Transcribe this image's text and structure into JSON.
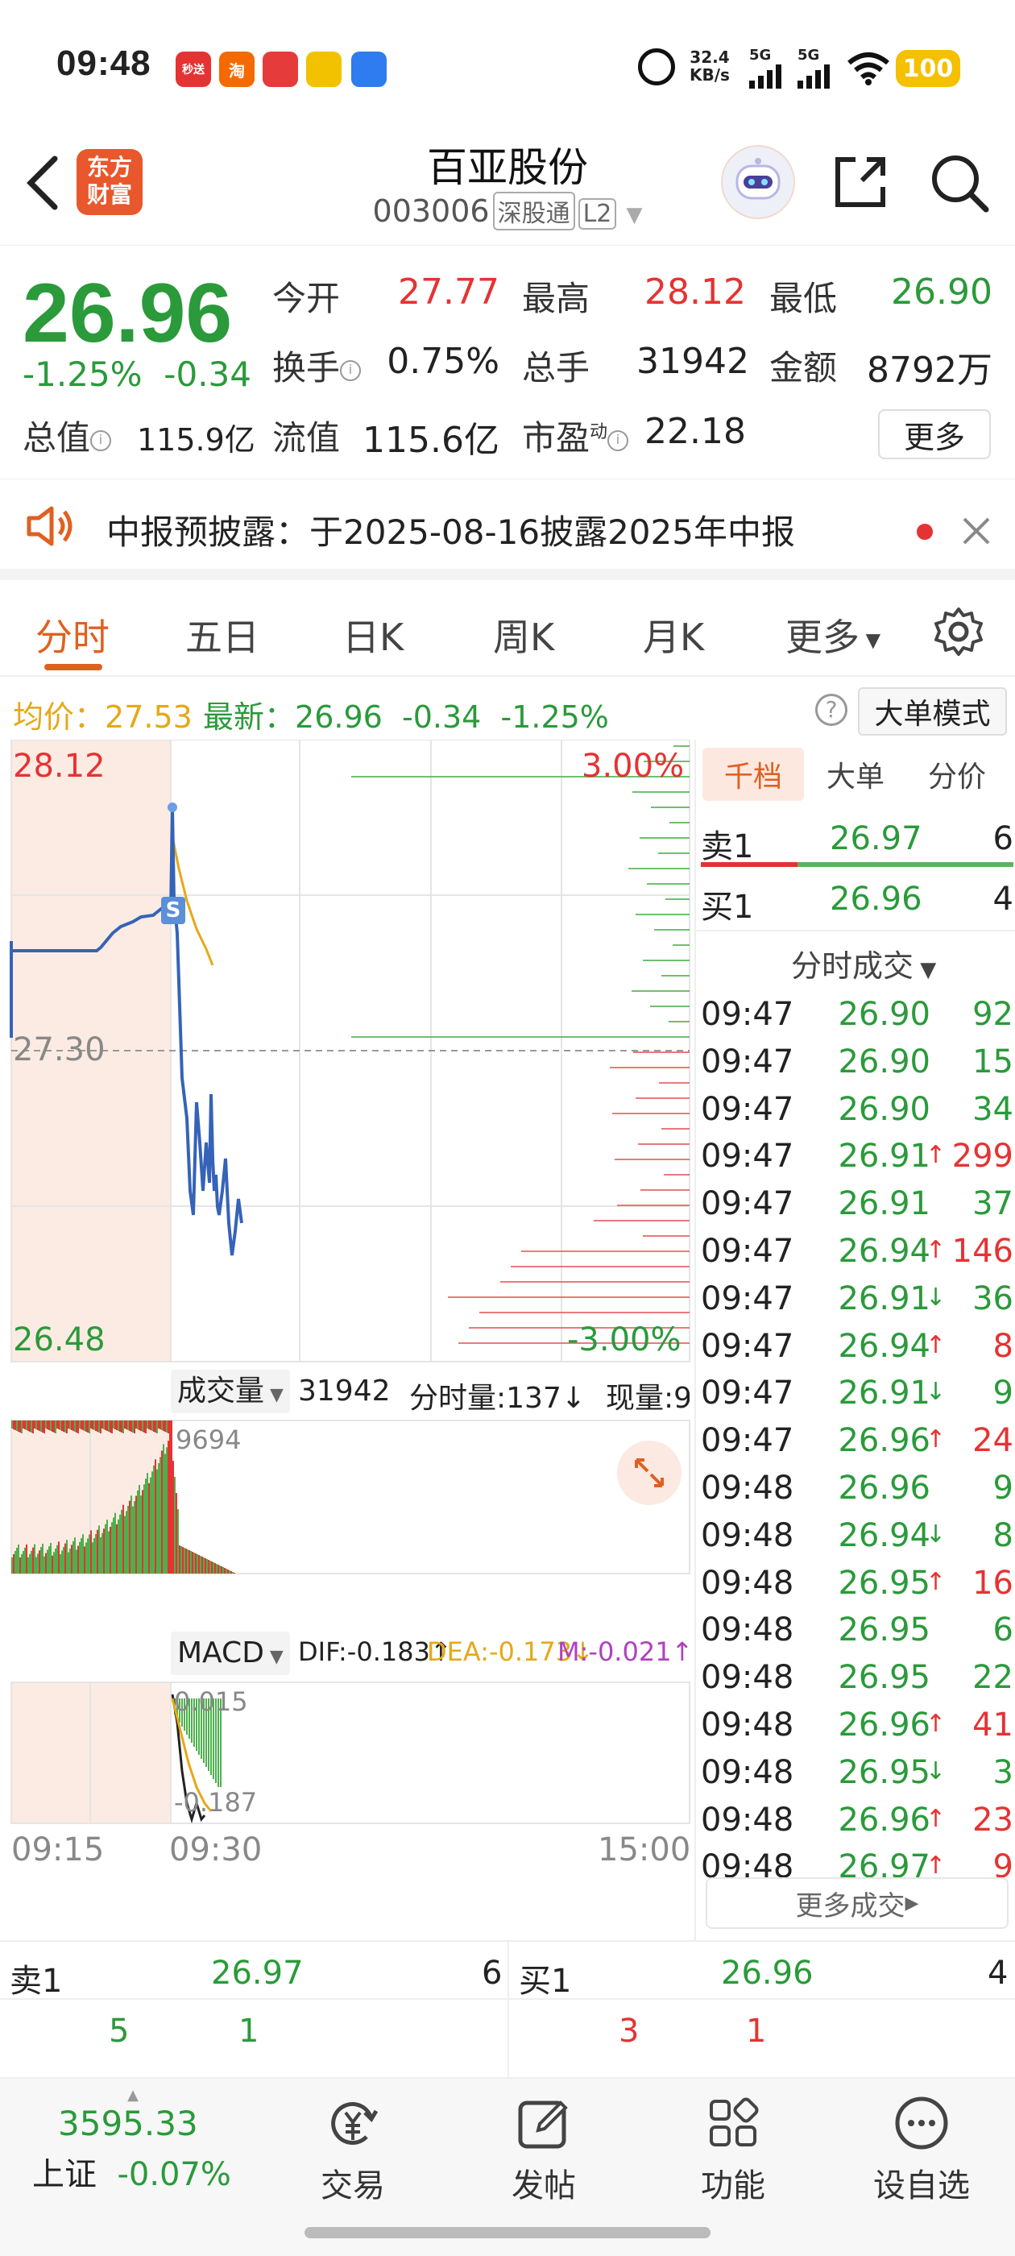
{
  "status_bar": {
    "time": "09:48",
    "net_speed": "32.4\nKB/s",
    "net_top": "32.4",
    "net_bottom": "KB/s",
    "signal1": "5G",
    "signal2": "5G",
    "battery": "100",
    "app_icons": [
      "秒送",
      "淘",
      "",
      "",
      ""
    ]
  },
  "header": {
    "logo_line1": "东方",
    "logo_line2": "财富",
    "stock_name": "百亚股份",
    "stock_code": "003006",
    "tag1": "深股通",
    "tag2": "L2"
  },
  "quote": {
    "price": "26.96",
    "change_pct": "-1.25%",
    "change": "-0.34",
    "open_label": "今开",
    "open_value": "27.77",
    "high_label": "最高",
    "high_value": "28.12",
    "low_label": "最低",
    "low_value": "26.90",
    "turnover_label": "换手",
    "turnover_value": "0.75%",
    "volume_label": "总手",
    "volume_value": "31942",
    "amount_label": "金额",
    "amount_value": "8792万",
    "mktcap_label": "总值",
    "mktcap_value": "115.9亿",
    "float_label": "流值",
    "float_value": "115.6亿",
    "pe_label": "市盈",
    "pe_sup": "动",
    "pe_value": "22.18",
    "more": "更多"
  },
  "notice": {
    "text": "中报预披露：于2025-08-16披露2025年中报"
  },
  "tabs": [
    "分时",
    "五日",
    "日K",
    "周K",
    "月K",
    "更多"
  ],
  "avg_line": {
    "avg_label": "均价：",
    "avg_value": "27.53",
    "latest_label": "最新：",
    "latest_value": "26.96",
    "change": "-0.34",
    "change_pct": "-1.25%",
    "mode_button": "大单模式"
  },
  "chart": {
    "y_high": "28.12",
    "y_mid": "27.30",
    "y_low": "26.48",
    "pct_high": "3.00%",
    "pct_low": "-3.00%",
    "marker": "S",
    "volume_label": "成交量",
    "volume_total": "31942",
    "tick_volume": "分时量:137↓",
    "current_volume": "现量:9",
    "vol_max": "9694",
    "macd_label": "MACD",
    "dif": "DIF:-0.183↑",
    "dea": "DEA:-0.173↓",
    "m": "M:-0.021↑",
    "macd_high": "0.015",
    "macd_low": "-0.187",
    "time_start": "09:15",
    "time_open": "09:30",
    "time_end": "15:00"
  },
  "order_book": {
    "tabs": [
      "千档",
      "大单",
      "分价"
    ],
    "sell1_label": "卖1",
    "sell1_price": "26.97",
    "sell1_qty": "6",
    "buy1_label": "买1",
    "buy1_price": "26.96",
    "buy1_qty": "4",
    "ticks_title": "分时成交",
    "ticks": [
      {
        "time": "09:47",
        "price": "26.90",
        "arrow": "",
        "qty": "92",
        "color": "green"
      },
      {
        "time": "09:47",
        "price": "26.90",
        "arrow": "",
        "qty": "15",
        "color": "green"
      },
      {
        "time": "09:47",
        "price": "26.90",
        "arrow": "",
        "qty": "34",
        "color": "green"
      },
      {
        "time": "09:47",
        "price": "26.91",
        "arrow": "↑",
        "qty": "299",
        "color": "red"
      },
      {
        "time": "09:47",
        "price": "26.91",
        "arrow": "",
        "qty": "37",
        "color": "green"
      },
      {
        "time": "09:47",
        "price": "26.94",
        "arrow": "↑",
        "qty": "146",
        "color": "red"
      },
      {
        "time": "09:47",
        "price": "26.91",
        "arrow": "↓",
        "qty": "36",
        "color": "green"
      },
      {
        "time": "09:47",
        "price": "26.94",
        "arrow": "↑",
        "qty": "8",
        "color": "red"
      },
      {
        "time": "09:47",
        "price": "26.91",
        "arrow": "↓",
        "qty": "9",
        "color": "green"
      },
      {
        "time": "09:47",
        "price": "26.96",
        "arrow": "↑",
        "qty": "24",
        "color": "red"
      },
      {
        "time": "09:48",
        "price": "26.96",
        "arrow": "",
        "qty": "9",
        "color": "green"
      },
      {
        "time": "09:48",
        "price": "26.94",
        "arrow": "↓",
        "qty": "8",
        "color": "green"
      },
      {
        "time": "09:48",
        "price": "26.95",
        "arrow": "↑",
        "qty": "16",
        "color": "red"
      },
      {
        "time": "09:48",
        "price": "26.95",
        "arrow": "",
        "qty": "6",
        "color": "green"
      },
      {
        "time": "09:48",
        "price": "26.95",
        "arrow": "",
        "qty": "22",
        "color": "green"
      },
      {
        "time": "09:48",
        "price": "26.96",
        "arrow": "↑",
        "qty": "41",
        "color": "red"
      },
      {
        "time": "09:48",
        "price": "26.95",
        "arrow": "↓",
        "qty": "3",
        "color": "green"
      },
      {
        "time": "09:48",
        "price": "26.96",
        "arrow": "↑",
        "qty": "23",
        "color": "red"
      },
      {
        "time": "09:48",
        "price": "26.97",
        "arrow": "↑",
        "qty": "9",
        "color": "red"
      }
    ],
    "more_ticks": "更多成交"
  },
  "level1": {
    "sell_label": "卖1",
    "sell_price": "26.97",
    "sell_qty": "6",
    "sell_a": "5",
    "sell_b": "1",
    "buy_label": "买1",
    "buy_price": "26.96",
    "buy_qty": "4",
    "buy_a": "3",
    "buy_b": "1"
  },
  "bottom_nav": {
    "index_value": "3595.33",
    "index_name": "上证",
    "index_change": "-0.07%",
    "items": [
      "交易",
      "发帖",
      "功能",
      "设自选"
    ]
  },
  "colors": {
    "up": "#e53333",
    "down": "#2a9a3a",
    "accent": "#e06020",
    "avg_line": "#e6a817"
  }
}
